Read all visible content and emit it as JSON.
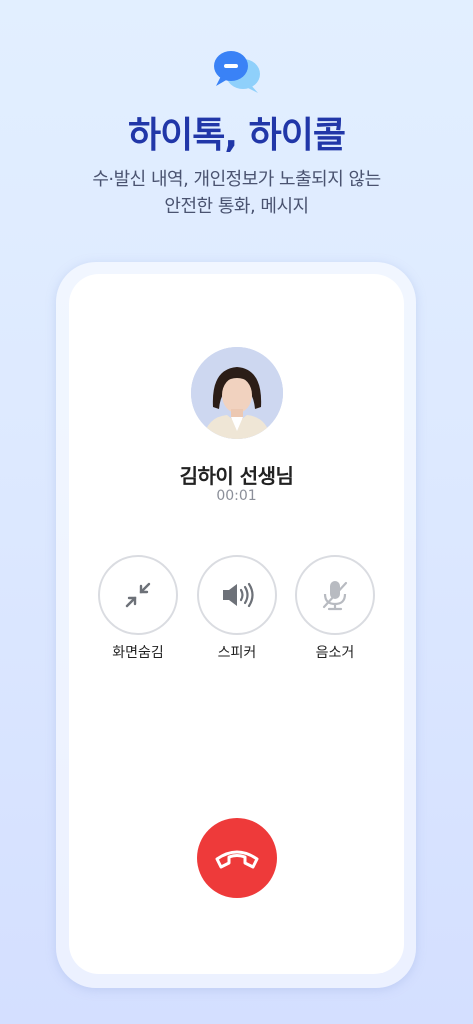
{
  "header": {
    "title": "하이톡, 하이콜",
    "subtitle_line1": "수·발신 내역, 개인정보가 노출되지 않는",
    "subtitle_line2": "안전한 통화, 메시지"
  },
  "call": {
    "caller_name": "김하이 선생님",
    "duration": "00:01"
  },
  "controls": {
    "minimize_label": "화면숨김",
    "speaker_label": "스피커",
    "mute_label": "음소거"
  },
  "colors": {
    "title": "#2137a8",
    "end_call": "#ee3a3a",
    "logo_blue": "#3a82f6",
    "logo_light": "#8fd0fb"
  }
}
